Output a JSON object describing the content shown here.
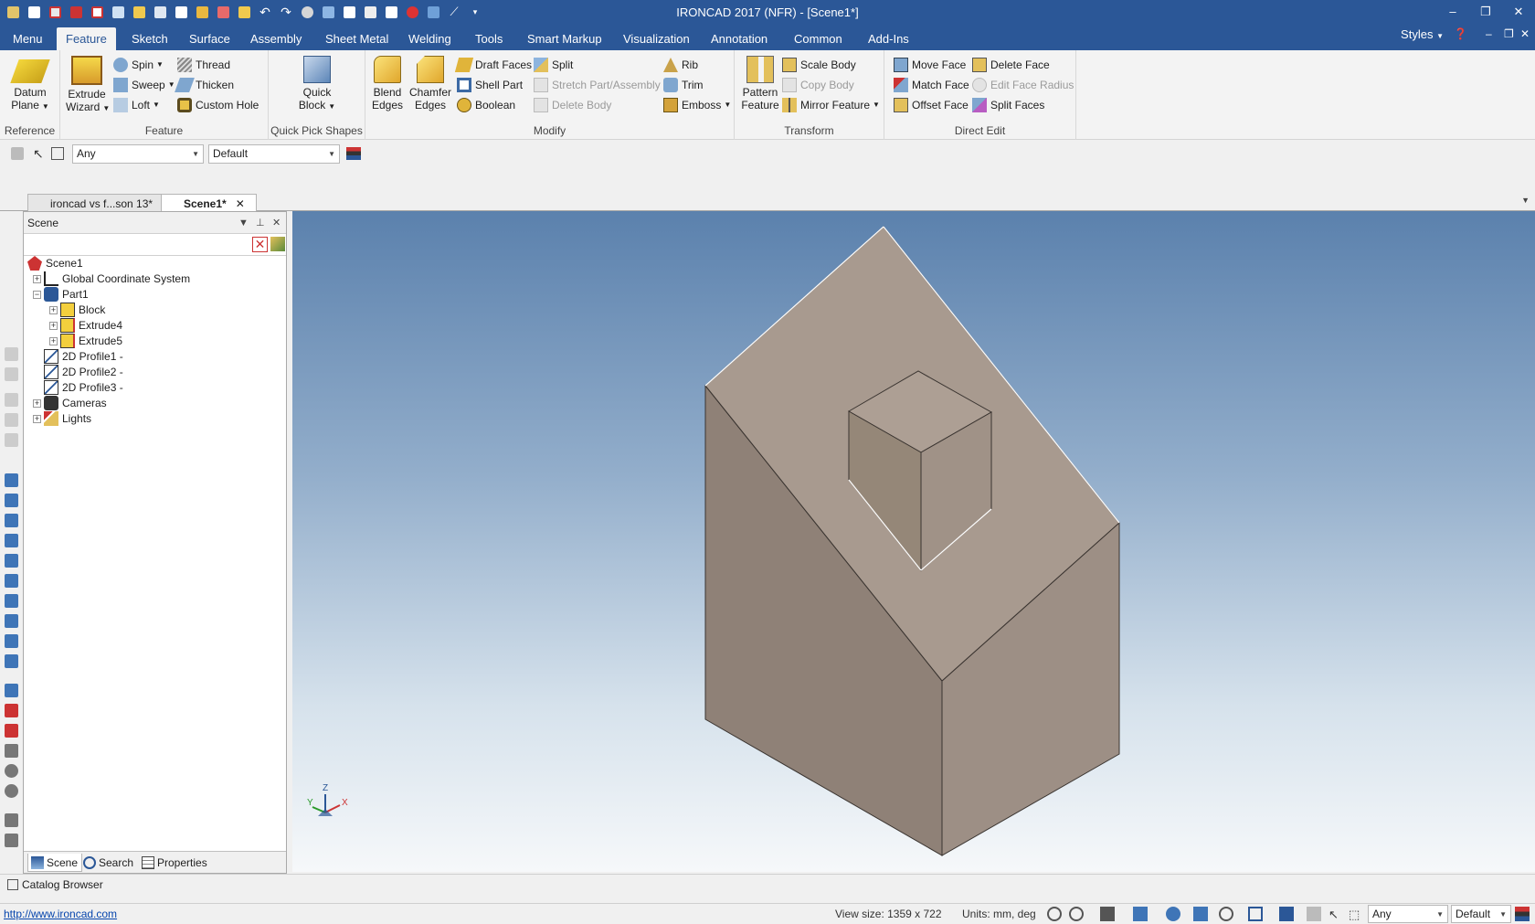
{
  "window": {
    "title": "IRONCAD 2017 (NFR) - [Scene1*]",
    "minimize": "–",
    "restore": "❐",
    "close": "✕"
  },
  "ribbon_tabs": [
    "Menu",
    "Feature",
    "Sketch",
    "Surface",
    "Assembly",
    "Sheet Metal",
    "Welding",
    "Tools",
    "Smart Markup",
    "Visualization",
    "Annotation",
    "Common",
    "Add-Ins"
  ],
  "active_tab": "Feature",
  "styles_label": "Styles",
  "ribbon": {
    "reference": {
      "name": "Reference",
      "datum_line1": "Datum",
      "datum_line2": "Plane"
    },
    "feature": {
      "name": "Feature",
      "extrude_line1": "Extrude",
      "extrude_line2": "Wizard",
      "spin": "Spin",
      "sweep": "Sweep",
      "loft": "Loft",
      "thread": "Thread",
      "thicken": "Thicken",
      "custom_hole": "Custom Hole"
    },
    "quick_pick": {
      "name": "Quick Pick Shapes",
      "qb_line1": "Quick",
      "qb_line2": "Block"
    },
    "modify": {
      "name": "Modify",
      "blend_line1": "Blend",
      "blend_line2": "Edges",
      "chamfer_line1": "Chamfer",
      "chamfer_line2": "Edges",
      "draft_faces": "Draft Faces",
      "shell_part": "Shell Part",
      "boolean": "Boolean",
      "split": "Split",
      "stretch": "Stretch Part/Assembly",
      "delete_body": "Delete Body",
      "rib": "Rib",
      "trim": "Trim",
      "emboss": "Emboss"
    },
    "transform": {
      "name": "Transform",
      "pattern_line1": "Pattern",
      "pattern_line2": "Feature",
      "scale_body": "Scale Body",
      "copy_body": "Copy Body",
      "mirror_feature": "Mirror Feature"
    },
    "direct_edit": {
      "name": "Direct Edit",
      "move_face": "Move Face",
      "match_face": "Match Face",
      "offset_face": "Offset Face",
      "delete_face": "Delete Face",
      "edit_face_radius": "Edit Face Radius",
      "split_faces": "Split Faces"
    }
  },
  "selection_toolbar": {
    "filter_value": "Any",
    "style_value": "Default"
  },
  "doc_tabs": [
    {
      "label": "ironcad vs f...son 13*"
    },
    {
      "label": "Scene1*",
      "close": "✕"
    }
  ],
  "scene_panel": {
    "title": "Scene",
    "tree": [
      {
        "label": "Scene1"
      },
      {
        "label": "Global Coordinate System"
      },
      {
        "label": "Part1"
      },
      {
        "label": "Block"
      },
      {
        "label": "Extrude4"
      },
      {
        "label": "Extrude5"
      },
      {
        "label": "2D Profile1 -"
      },
      {
        "label": "2D Profile2 -"
      },
      {
        "label": "2D Profile3 -"
      },
      {
        "label": "Cameras"
      },
      {
        "label": "Lights"
      }
    ],
    "tabs": [
      "Scene",
      "Search",
      "Properties"
    ]
  },
  "triad": {
    "x": "X",
    "y": "Y",
    "z": "Z"
  },
  "catalog_browser": "Catalog Browser",
  "status": {
    "url": "http://www.ironcad.com",
    "view_size": "View size: 1359 x  722",
    "units": "Units: mm, deg",
    "filter_value": "Any",
    "style_value": "Default"
  },
  "colors": {
    "accent": "#2b5797",
    "model_top": "#a89a8f",
    "model_left": "#8f8177",
    "model_right": "#9d8f85"
  }
}
